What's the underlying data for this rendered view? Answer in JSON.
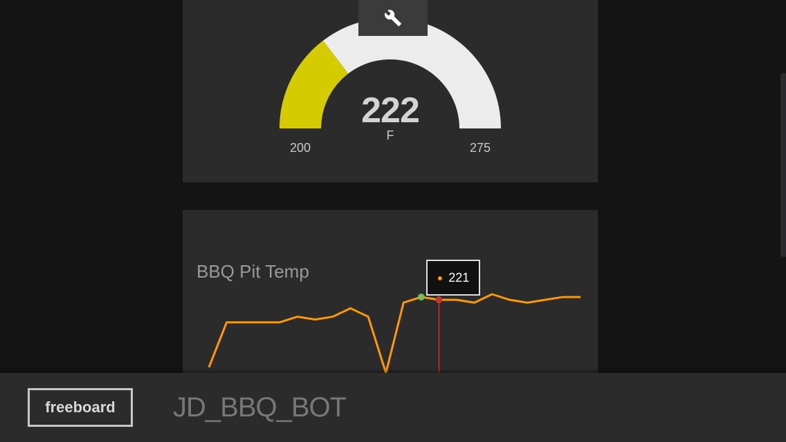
{
  "gauge": {
    "value": "222",
    "units": "F",
    "min": "200",
    "max": "275",
    "fraction": 0.293,
    "fill_color": "#d4cc00",
    "track_color": "#ececec"
  },
  "toolbar": {
    "tool_icon": "wrench-icon"
  },
  "chart": {
    "title": "BBQ Pit Temp",
    "tooltip_value": "221",
    "line_color": "#ff9900",
    "highlight_point_color": "#7cba5a",
    "cursor_point_color": "#c0392b"
  },
  "chart_data": {
    "type": "line",
    "title": "BBQ Pit Temp",
    "series": [
      {
        "values": [
          198,
          214,
          214,
          214,
          214,
          216,
          215,
          216,
          219,
          216,
          196,
          221,
          223,
          222,
          222,
          221,
          224,
          222,
          221,
          222,
          223,
          223
        ]
      }
    ],
    "grid": false
  },
  "footer": {
    "logo_label": "freeboard",
    "board_title": "JD_BBQ_BOT"
  }
}
